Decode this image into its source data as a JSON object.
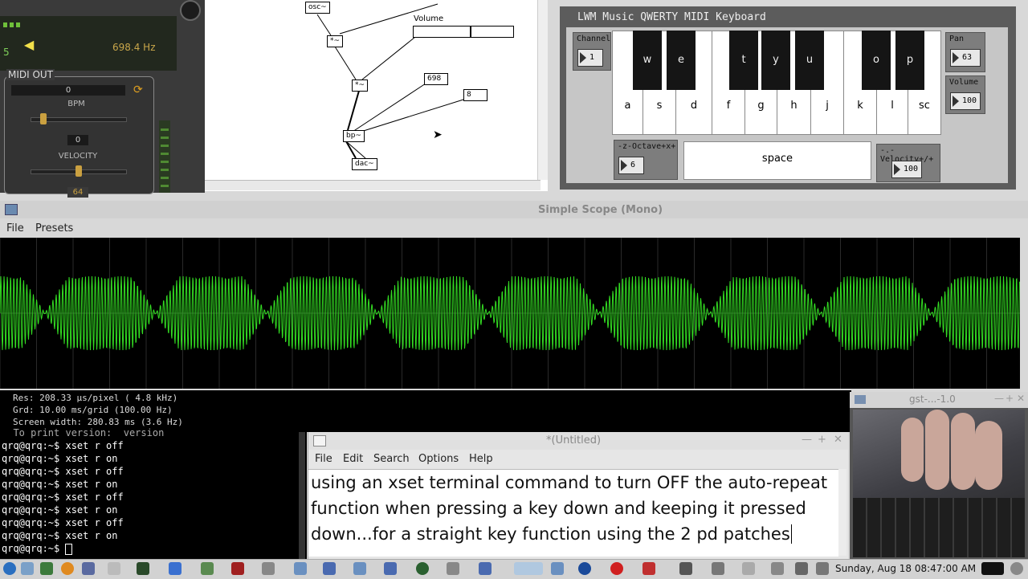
{
  "synth_panel": {
    "frequency": "698.4 Hz",
    "value_5": "5",
    "midi_out_title": "MIDI OUT",
    "bpm_value": "0",
    "bpm_label": "BPM",
    "velocity_value": "0",
    "velocity_label": "VELOCITY",
    "bottom_value": "64"
  },
  "pd_patch": {
    "objects": {
      "osc": "osc~",
      "mul1": "*~",
      "mul2": "*~",
      "bp": "bp~",
      "dac": "dac~",
      "num698": "698",
      "num8": "8"
    },
    "volume_label": "Volume",
    "volume_level": 0.57
  },
  "keyboard": {
    "title": "LWM Music QWERTY MIDI Keyboard",
    "channel_label": "Channel",
    "channel_value": "1",
    "white_keys": [
      "a",
      "s",
      "d",
      "f",
      "g",
      "h",
      "j",
      "k",
      "l",
      "sc"
    ],
    "black_keys": [
      "w",
      "e",
      "t",
      "y",
      "u",
      "o",
      "p"
    ],
    "space_label": "space",
    "octave_label": "-z-Octave+x+",
    "octave_value": "6",
    "velocity_label": "-.-Velocity+/+",
    "velocity_value": "100",
    "pan_label": "Pan",
    "pan_value": "63",
    "volume_label": "Volume",
    "volume_value": "100"
  },
  "scope": {
    "title": "Simple Scope (Mono)",
    "menu": [
      "File",
      "Presets"
    ],
    "res": "Res: 208.33 µs/pixel (  4.8 kHz)",
    "grd": "Grd:  10.00 ms/grid (100.00 Hz)",
    "screen_width": "Screen width: 280.83 ms (3.6 Hz)",
    "trace_color": "#33dd22"
  },
  "terminal": {
    "partial_line": "  To print version:  version",
    "lines": [
      {
        "prompt": "qrq@qrq:~$",
        "cmd": " xset r off"
      },
      {
        "prompt": "qrq@qrq:~$",
        "cmd": " xset r on"
      },
      {
        "prompt": "qrq@qrq:~$",
        "cmd": " xset r off"
      },
      {
        "prompt": "qrq@qrq:~$",
        "cmd": " xset r on"
      },
      {
        "prompt": "qrq@qrq:~$",
        "cmd": " xset r off"
      },
      {
        "prompt": "qrq@qrq:~$",
        "cmd": " xset r on"
      },
      {
        "prompt": "qrq@qrq:~$",
        "cmd": " xset r off"
      },
      {
        "prompt": "qrq@qrq:~$",
        "cmd": " xset r on"
      },
      {
        "prompt": "qrq@qrq:~$",
        "cmd": " "
      }
    ]
  },
  "editor": {
    "title": "*(Untitled)",
    "menu": [
      "File",
      "Edit",
      "Search",
      "Options",
      "Help"
    ],
    "lines": [
      "using an xset terminal command to turn OFF the auto-repeat",
      "function when pressing a key down and keeping it pressed",
      "down...for a straight key function using the 2 pd patches"
    ]
  },
  "video": {
    "title": "gst-...-1.0"
  },
  "taskbar": {
    "clock": "Sunday, Aug 18 08:47:00 AM"
  }
}
